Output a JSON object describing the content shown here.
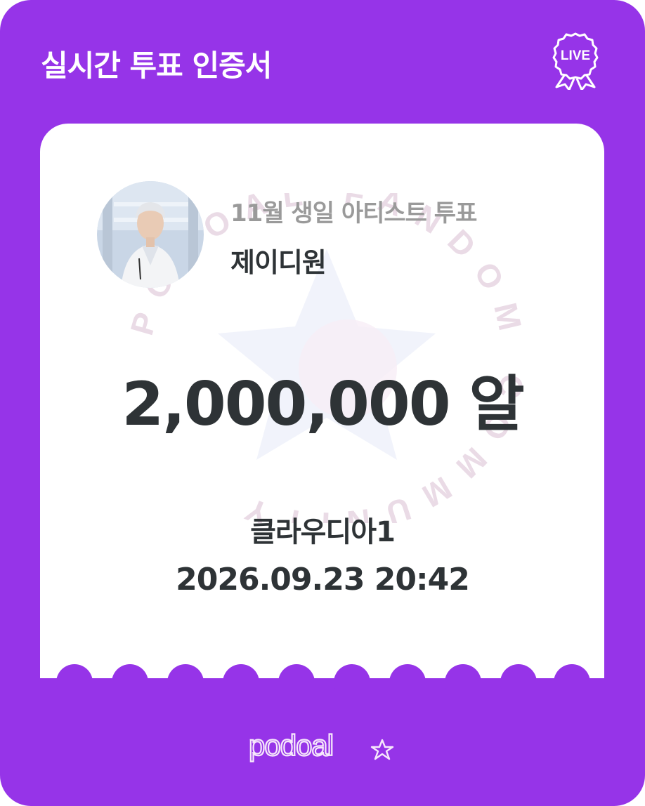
{
  "header": {
    "title": "실시간 투표 인증서",
    "live_badge": {
      "label": "LIVE",
      "icon": "ribbon-medal-icon"
    }
  },
  "certificate": {
    "vote_title": "11월 생일 아티스트 투표",
    "artist_name": "제이디원",
    "amount": "2,000,000 알",
    "voter_name": "클라우디아1",
    "datetime": "2026.09.23 20:42",
    "stamp_text": "PODOAL FANDOM COMMUNITY"
  },
  "footer": {
    "brand": "podoal"
  },
  "colors": {
    "brand_purple": "#9634e8",
    "card_bg": "#ffffff",
    "text_dark": "#2e3336",
    "text_gray": "#9a9a9a"
  }
}
